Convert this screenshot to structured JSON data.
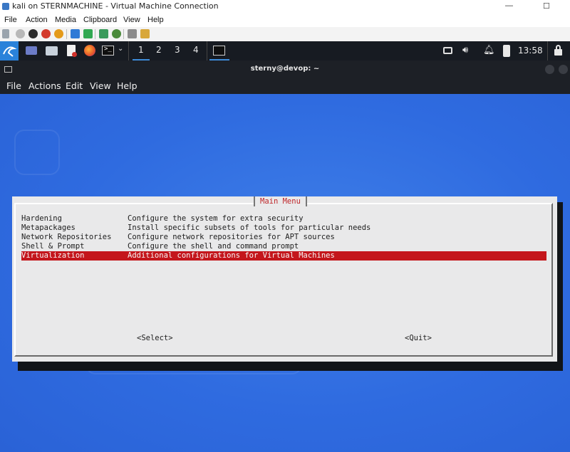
{
  "host": {
    "title": "kali on STERNMACHINE - Virtual Machine Connection",
    "menu": [
      "File",
      "Action",
      "Media",
      "Clipboard",
      "View",
      "Help"
    ]
  },
  "panel": {
    "workspaces": [
      "1",
      "2",
      "3",
      "4"
    ],
    "clock": "13:58"
  },
  "terminal": {
    "title": "sterny@devop: ~",
    "menu": [
      "File",
      "Actions",
      "Edit",
      "View",
      "Help"
    ]
  },
  "dialog": {
    "title": "Main Menu",
    "items": [
      {
        "key": "Hardening",
        "desc": "Configure the system for extra security"
      },
      {
        "key": "Metapackages",
        "desc": "Install specific subsets of tools for particular needs"
      },
      {
        "key": "Network Repositories",
        "desc": "Configure network repositories for APT sources"
      },
      {
        "key": "Shell & Prompt",
        "desc": "Configure the shell and command prompt"
      },
      {
        "key": "Virtualization",
        "desc": "Additional configurations for Virtual Machines"
      }
    ],
    "selected_index": 4,
    "select_label": "<Select>",
    "quit_label": "<Quit>"
  },
  "colors": {
    "desktop_blue": "#2f6be0",
    "selection_red": "#c4161c",
    "title_red": "#c0282b"
  }
}
